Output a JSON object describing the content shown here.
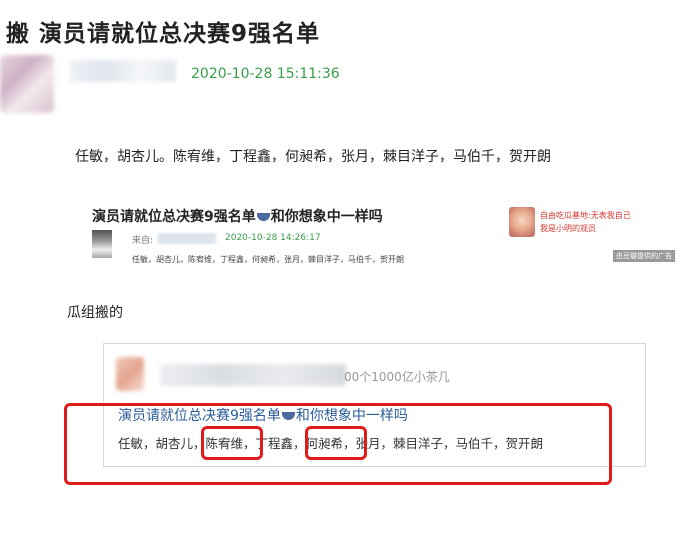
{
  "post": {
    "title": "搬 演员请就位总决赛9强名单",
    "timestamp": "2020-10-28 15:11:36",
    "body": "任敏，胡杏儿。陈宥维，丁程鑫，何昶希，张月，棘目洋子，马伯千，贺开朗",
    "section_label": "瓜组搬的"
  },
  "card1": {
    "title_a": "演员请就位总决赛9强名单",
    "title_b": "和你想象中一样吗",
    "meta_prefix": "来自:",
    "time": "2020-10-28 14:26:17",
    "body": "任敏，胡杏儿，陈宥维，丁程鑫，何昶希，张月，棘目洋子，马伯千，贺开朗"
  },
  "ad": {
    "line1": "自由吃瓜基地:无表我自己",
    "line2": "我是小明的观员",
    "tag": "由豆瓣提供的广告"
  },
  "card2": {
    "topic": "00个1000亿小茶几",
    "title_a": "演员请就位总决赛9强名单",
    "title_b": "和你想象中一样吗",
    "body": "任敏，胡杏儿，陈宥维，丁程鑫，何昶希，张月，棘目洋子，马伯千，贺开朗"
  },
  "colors": {
    "timestamp": "#3a9d4a",
    "highlight": "#e01b1b",
    "card_title": "#2a5d9a"
  }
}
